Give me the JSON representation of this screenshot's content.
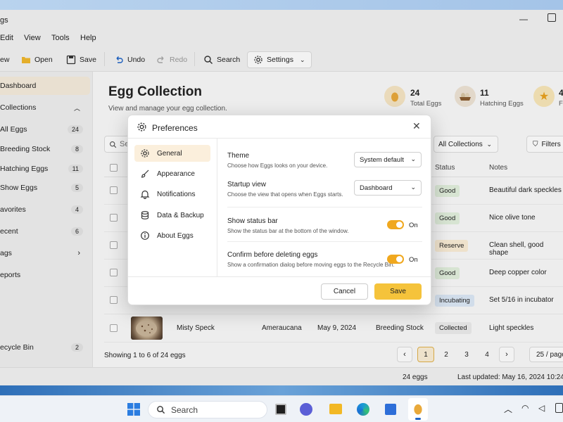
{
  "app": {
    "title_fragment": "gs"
  },
  "menu": [
    "Edit",
    "View",
    "Tools",
    "Help"
  ],
  "toolbar": {
    "new": "ew",
    "open": "Open",
    "save": "Save",
    "undo": "Undo",
    "redo": "Redo",
    "search": "Search",
    "settings": "Settings"
  },
  "sidebar": {
    "items": [
      {
        "label": "Dashboard",
        "count": ""
      },
      {
        "label": "Collections",
        "count": ""
      },
      {
        "label": "All Eggs",
        "count": "24"
      },
      {
        "label": "Breeding Stock",
        "count": "8"
      },
      {
        "label": "Hatching Eggs",
        "count": "11"
      },
      {
        "label": "Show Eggs",
        "count": "5"
      },
      {
        "label": "avorites",
        "count": "4"
      },
      {
        "label": "ecent",
        "count": "6"
      },
      {
        "label": "ags",
        "count": ""
      },
      {
        "label": "eports",
        "count": ""
      }
    ],
    "recycle": {
      "label": "ecycle Bin",
      "count": "2"
    }
  },
  "page": {
    "title": "Egg Collection",
    "subtitle": "View and manage your egg collection."
  },
  "stats": [
    {
      "value": "24",
      "label": "Total Eggs"
    },
    {
      "value": "11",
      "label": "Hatching Eggs"
    },
    {
      "value": "4",
      "label": "Fa"
    }
  ],
  "filters": {
    "search_placeholder": "Se",
    "collections": "All Collections",
    "filters": "Filters"
  },
  "table": {
    "headers": {
      "status": "Status",
      "notes": "Notes"
    },
    "rows": [
      {
        "status": "Good",
        "notes": "Beautiful dark speckles",
        "color": "#e3f1de"
      },
      {
        "status": "Good",
        "notes": "Nice olive tone",
        "color": "#e3f1de"
      },
      {
        "status": "Reserve",
        "notes": "Clean shell, good shape",
        "color": "#fbeed6"
      },
      {
        "status": "Good",
        "notes": "Deep copper color",
        "color": "#e3f1de"
      },
      {
        "status": "Incubating",
        "notes": "Set 5/16 in incubator",
        "color": "#dde9f7"
      }
    ],
    "last_row": {
      "name": "Misty Speck",
      "breed": "Ameraucana",
      "date": "May 9, 2024",
      "collection": "Breeding Stock",
      "status": "Collected",
      "notes": "Light speckles"
    }
  },
  "pagination": {
    "showing": "Showing 1 to 6 of 24 eggs",
    "pages": [
      "1",
      "2",
      "3",
      "4"
    ],
    "per_page": "25 / page"
  },
  "statusbar": {
    "count": "24 eggs",
    "updated": "Last updated: May 16, 2024 10:24 A"
  },
  "dialog": {
    "title": "Preferences",
    "nav": [
      {
        "label": "General"
      },
      {
        "label": "Appearance"
      },
      {
        "label": "Notifications"
      },
      {
        "label": "Data & Backup"
      },
      {
        "label": "About Eggs"
      }
    ],
    "theme": {
      "label": "Theme",
      "desc": "Choose how Eggs looks on your device.",
      "value": "System default"
    },
    "startup": {
      "label": "Startup view",
      "desc": "Choose the view that opens when Eggs starts.",
      "value": "Dashboard"
    },
    "status_bar": {
      "label": "Show status bar",
      "desc": "Show the status bar at the bottom of the window.",
      "state": "On"
    },
    "confirm": {
      "label": "Confirm before deleting eggs",
      "desc": "Show a confirmation dialog before moving eggs to the Recycle Bin.",
      "state": "On"
    },
    "cancel": "Cancel",
    "save": "Save"
  },
  "taskbar": {
    "search": "Search"
  },
  "colors": {
    "accent": "#f5c33b",
    "toggle": "#f0a81e",
    "active_nav": "#fbefdc"
  }
}
